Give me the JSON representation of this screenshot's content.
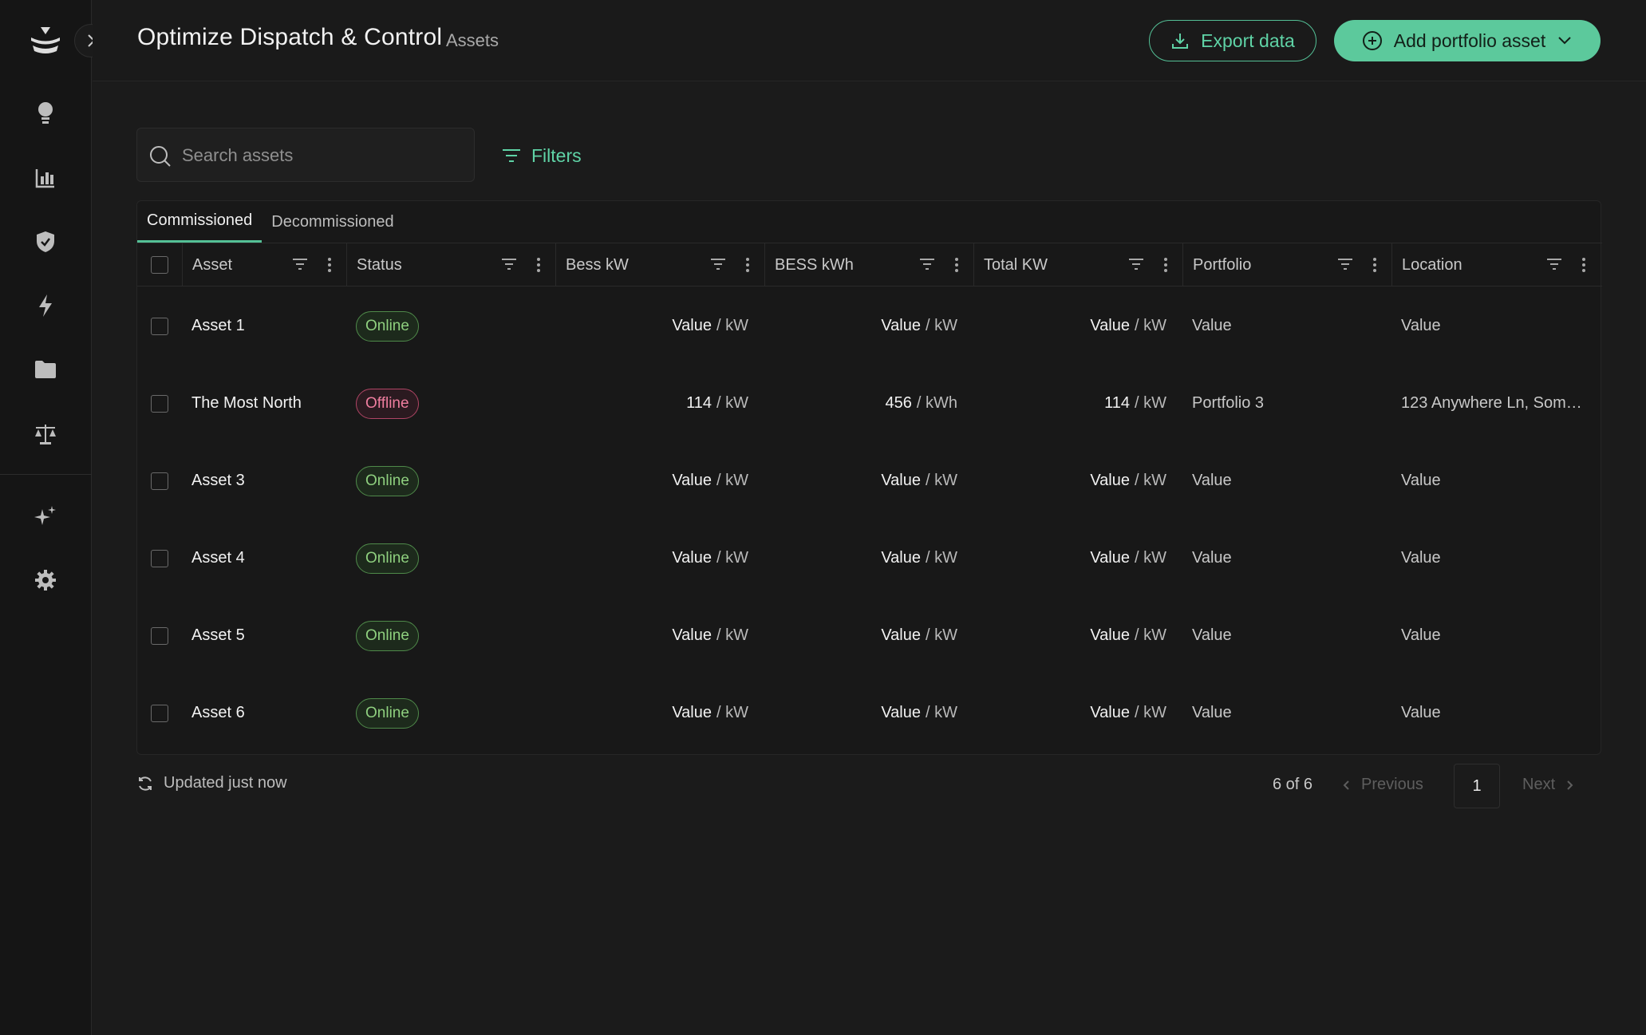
{
  "header": {
    "title": "Optimize Dispatch & Control",
    "subtitle": "Assets",
    "export_label": "Export data",
    "add_label": "Add portfolio asset"
  },
  "toolbar": {
    "search_placeholder": "Search assets",
    "filters_label": "Filters"
  },
  "tabs": [
    {
      "label": "Commissioned",
      "active": true
    },
    {
      "label": "Decommissioned",
      "active": false
    }
  ],
  "columns": [
    "Asset",
    "Status",
    "Bess kW",
    "BESS kWh",
    "Total KW",
    "Portfolio",
    "Location"
  ],
  "rows": [
    {
      "asset": "Asset 1",
      "status": "Online",
      "status_type": "online",
      "bess_kw": "Value",
      "bess_kw_unit": "/ kW",
      "bess_kwh": "Value",
      "bess_kwh_unit": "/ kW",
      "total_kw": "Value",
      "total_kw_unit": "/ kW",
      "portfolio": "Value",
      "location": "Value"
    },
    {
      "asset": "The Most North",
      "status": "Offline",
      "status_type": "offline",
      "bess_kw": "114",
      "bess_kw_unit": "/ kW",
      "bess_kwh": "456",
      "bess_kwh_unit": "/ kWh",
      "total_kw": "114",
      "total_kw_unit": "/ kW",
      "portfolio": "Portfolio 3",
      "location": "123 Anywhere Ln, Som…"
    },
    {
      "asset": "Asset 3",
      "status": "Online",
      "status_type": "online",
      "bess_kw": "Value",
      "bess_kw_unit": "/ kW",
      "bess_kwh": "Value",
      "bess_kwh_unit": "/ kW",
      "total_kw": "Value",
      "total_kw_unit": "/ kW",
      "portfolio": "Value",
      "location": "Value"
    },
    {
      "asset": "Asset 4",
      "status": "Online",
      "status_type": "online",
      "bess_kw": "Value",
      "bess_kw_unit": "/ kW",
      "bess_kwh": "Value",
      "bess_kwh_unit": "/ kW",
      "total_kw": "Value",
      "total_kw_unit": "/ kW",
      "portfolio": "Value",
      "location": "Value"
    },
    {
      "asset": "Asset 5",
      "status": "Online",
      "status_type": "online",
      "bess_kw": "Value",
      "bess_kw_unit": "/ kW",
      "bess_kwh": "Value",
      "bess_kwh_unit": "/ kW",
      "total_kw": "Value",
      "total_kw_unit": "/ kW",
      "portfolio": "Value",
      "location": "Value"
    },
    {
      "asset": "Asset 6",
      "status": "Online",
      "status_type": "online",
      "bess_kw": "Value",
      "bess_kw_unit": "/ kW",
      "bess_kwh": "Value",
      "bess_kwh_unit": "/ kW",
      "total_kw": "Value",
      "total_kw_unit": "/ kW",
      "portfolio": "Value",
      "location": "Value"
    }
  ],
  "footer": {
    "updated": "Updated just now",
    "count": "6 of 6",
    "previous": "Previous",
    "page": "1",
    "next": "Next"
  },
  "sidebar": {
    "icons": [
      "logo-icon",
      "lightbulb-icon",
      "bar-chart-icon",
      "shield-icon",
      "lightning-icon",
      "folder-icon",
      "scale-icon",
      "sparkles-icon",
      "gear-icon"
    ]
  },
  "colors": {
    "accent": "#5cc99c",
    "online": "#8fd07f",
    "offline": "#ee7d9e",
    "background": "#1b1b1b"
  }
}
